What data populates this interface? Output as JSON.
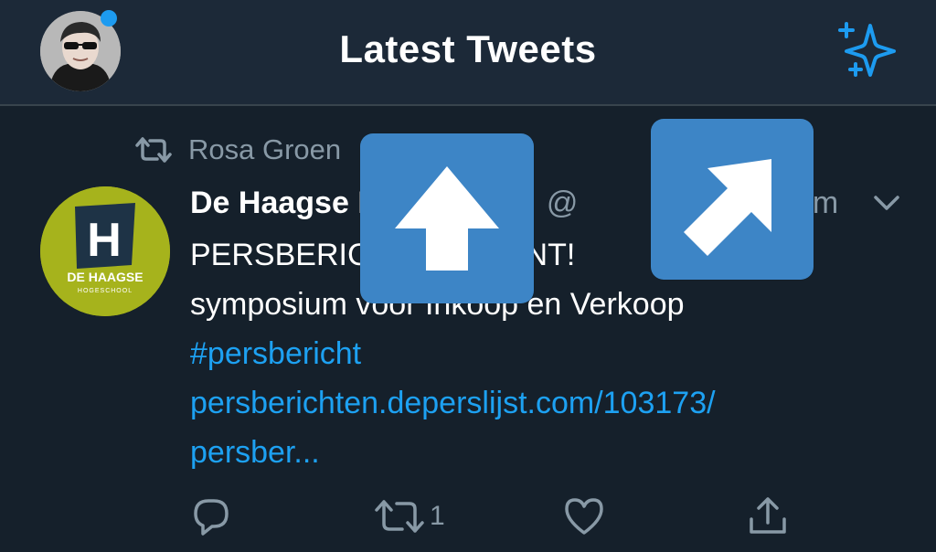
{
  "header": {
    "title": "Latest Tweets",
    "avatar_icon": "profile-avatar",
    "notification_dot_color": "#1d9bf0",
    "sparkle_icon": "sparkle-icon"
  },
  "tweet": {
    "retweeted_by": "Rosa Groen",
    "display_name": "De Haagse Hogeschool",
    "handle": "@",
    "time": "1m",
    "avatar_text_top": "DE HAAGSE",
    "avatar_text_bottom": "HOGESCHOOL",
    "avatar_letter": "H",
    "text_lines": [
      "PERSBERICHT: ... LOONT!",
      "symposium voor Inkoop en Verkoop"
    ],
    "hashtag": "#persbericht",
    "link_line_1": "persberichten.deperslijst.com/103173/",
    "link_line_2": "persber...",
    "actions": {
      "reply_icon": "reply-icon",
      "retweet_icon": "retweet-icon",
      "retweet_count": "1",
      "like_icon": "heart-icon",
      "share_icon": "share-icon"
    }
  },
  "overlays": {
    "up_arrow_icon": "arrow-up-icon",
    "diagonal_arrow_icon": "arrow-up-right-icon",
    "button_color": "#3d85c6"
  },
  "colors": {
    "background": "#15202b",
    "header": "#1c2938",
    "accent": "#1da1f2",
    "muted": "#8899a6",
    "org_green": "#a6b31c"
  }
}
